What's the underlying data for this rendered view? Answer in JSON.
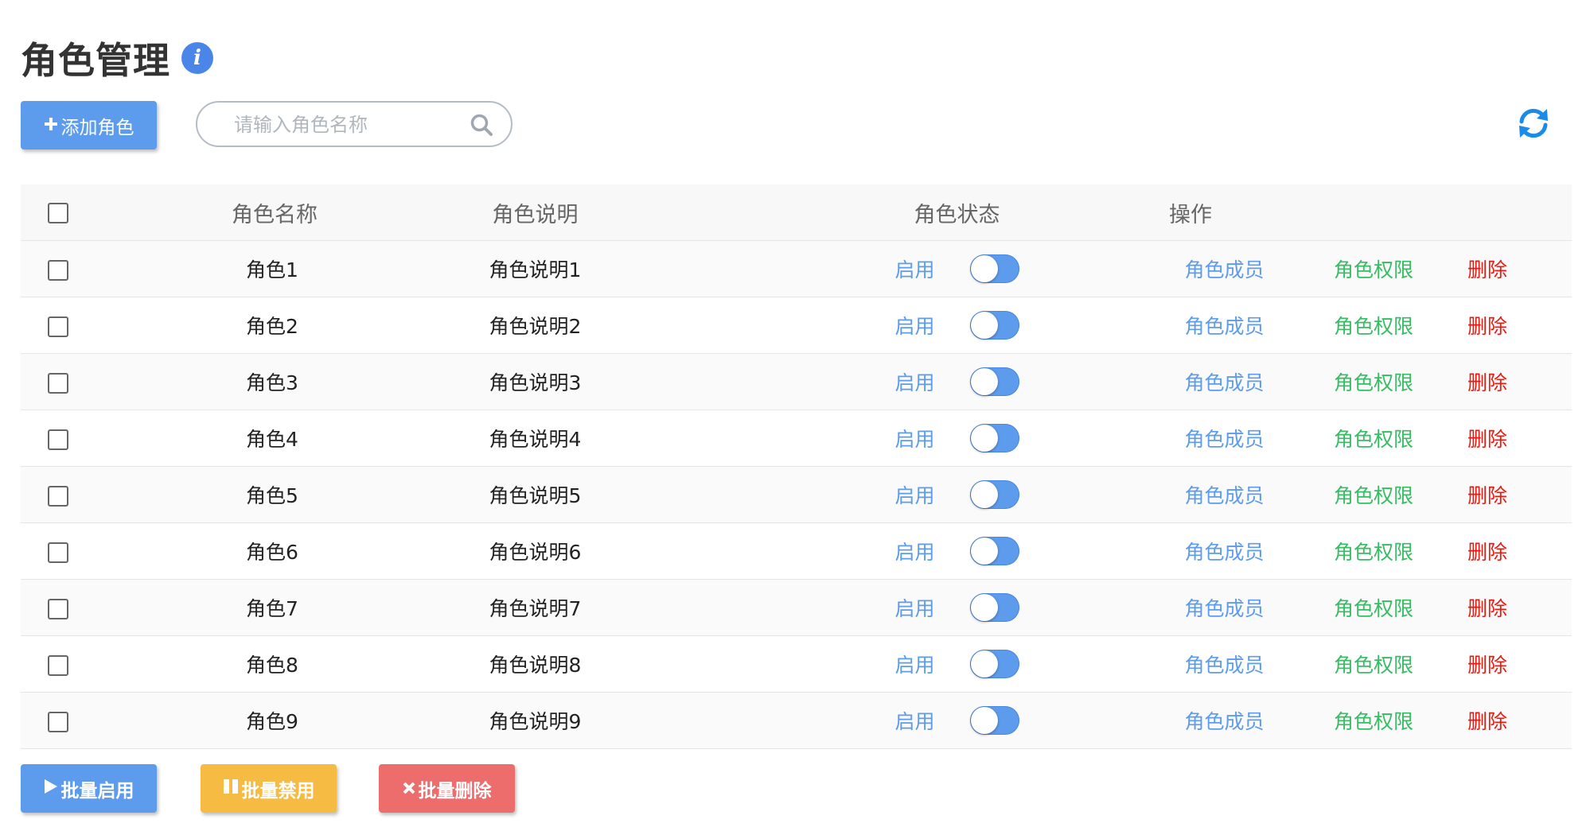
{
  "page": {
    "title": "角色管理",
    "info_icon": "info-icon"
  },
  "toolbar": {
    "add_label": "添加角色",
    "add_icon": "plus-icon",
    "search_placeholder": "请输入角色名称",
    "search_icon": "search-icon",
    "refresh_icon": "refresh-icon"
  },
  "table": {
    "headers": [
      "角色名称",
      "角色说明",
      "角色状态",
      "操作"
    ],
    "rows": [
      {
        "name": "角色1",
        "desc": "角色说明1",
        "status": "启用",
        "enabled": true,
        "members": "角色成员",
        "perms": "角色权限",
        "delete": "删除"
      },
      {
        "name": "角色2",
        "desc": "角色说明2",
        "status": "启用",
        "enabled": true,
        "members": "角色成员",
        "perms": "角色权限",
        "delete": "删除"
      },
      {
        "name": "角色3",
        "desc": "角色说明3",
        "status": "启用",
        "enabled": true,
        "members": "角色成员",
        "perms": "角色权限",
        "delete": "删除"
      },
      {
        "name": "角色4",
        "desc": "角色说明4",
        "status": "启用",
        "enabled": true,
        "members": "角色成员",
        "perms": "角色权限",
        "delete": "删除"
      },
      {
        "name": "角色5",
        "desc": "角色说明5",
        "status": "启用",
        "enabled": true,
        "members": "角色成员",
        "perms": "角色权限",
        "delete": "删除"
      },
      {
        "name": "角色6",
        "desc": "角色说明6",
        "status": "启用",
        "enabled": true,
        "members": "角色成员",
        "perms": "角色权限",
        "delete": "删除"
      },
      {
        "name": "角色7",
        "desc": "角色说明7",
        "status": "启用",
        "enabled": true,
        "members": "角色成员",
        "perms": "角色权限",
        "delete": "删除"
      },
      {
        "name": "角色8",
        "desc": "角色说明8",
        "status": "启用",
        "enabled": true,
        "members": "角色成员",
        "perms": "角色权限",
        "delete": "删除"
      },
      {
        "name": "角色9",
        "desc": "角色说明9",
        "status": "启用",
        "enabled": true,
        "members": "角色成员",
        "perms": "角色权限",
        "delete": "删除"
      }
    ]
  },
  "footer": {
    "bulk_enable": "批量启用",
    "bulk_disable": "批量禁用",
    "bulk_delete": "批量删除"
  },
  "colors": {
    "primary": "#5d9cec",
    "success": "#37bc63",
    "danger": "#e8190f",
    "warning": "#f6bb42",
    "danger_button": "#ed6c6c"
  }
}
